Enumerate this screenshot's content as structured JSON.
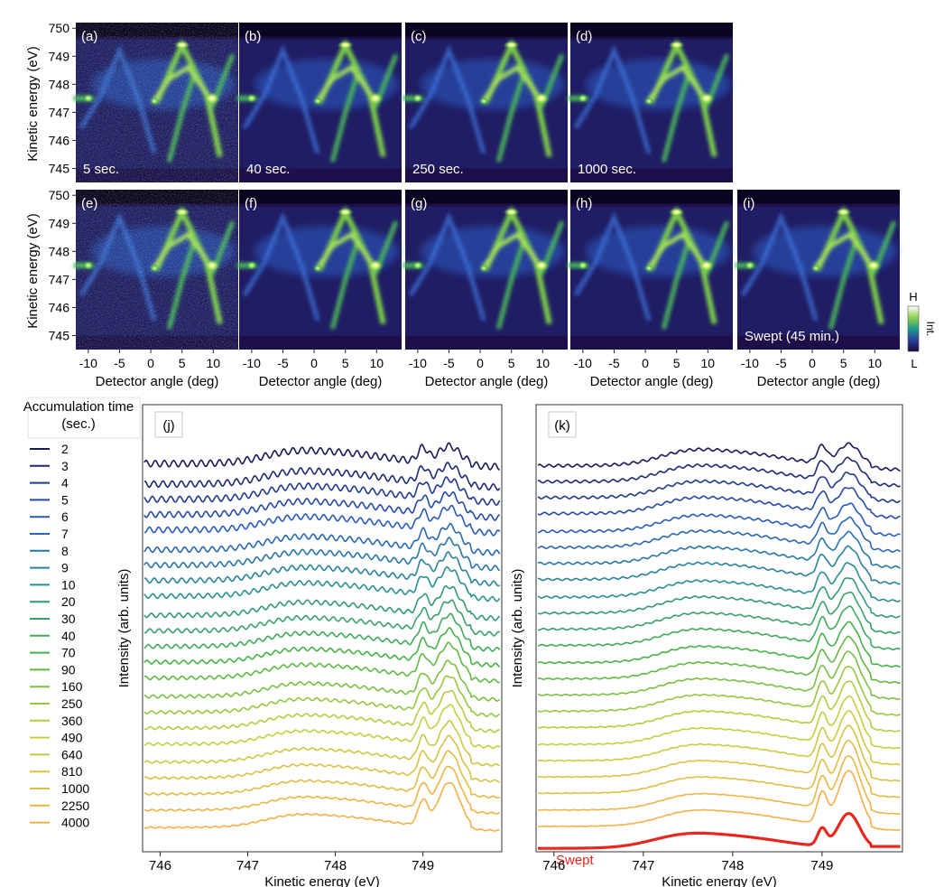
{
  "figure": {
    "maps_ylabel": "Kinetic energy (eV)",
    "maps_xlabel": "Detector angle (deg)",
    "colorbar": {
      "high": "H",
      "low": "L",
      "label": "Int."
    },
    "colors": {
      "dark": "#20205a",
      "mid": "#2aa36b",
      "light": "#f2b347",
      "swept": "#e8281e"
    }
  },
  "chart_data": [
    {
      "type": "heatmap",
      "panels": [
        {
          "label": "(a)",
          "caption": "5 sec."
        },
        {
          "label": "(b)",
          "caption": "40 sec."
        },
        {
          "label": "(c)",
          "caption": "250 sec."
        },
        {
          "label": "(d)",
          "caption": "1000 sec."
        },
        {
          "label": "(e)",
          "caption": ""
        },
        {
          "label": "(f)",
          "caption": ""
        },
        {
          "label": "(g)",
          "caption": ""
        },
        {
          "label": "(h)",
          "caption": ""
        },
        {
          "label": "(i)",
          "caption": "Swept (45 min.)"
        }
      ],
      "xlim": [
        -12,
        14
      ],
      "ylim": [
        744.5,
        750.2
      ],
      "xticks": [
        -10,
        -5,
        0,
        5,
        10
      ],
      "yticks": [
        745,
        746,
        747,
        748,
        749,
        750
      ],
      "xlabel": "Detector angle (deg)",
      "ylabel": "Kinetic energy (eV)"
    },
    {
      "type": "line",
      "panel": "(j)",
      "legend_title": "Accumulation time (sec.)",
      "series_names": [
        "2",
        "3",
        "4",
        "5",
        "6",
        "7",
        "8",
        "9",
        "10",
        "20",
        "30",
        "40",
        "70",
        "90",
        "160",
        "250",
        "360",
        "490",
        "640",
        "810",
        "1000",
        "2250",
        "4000"
      ],
      "xlim": [
        745.8,
        749.9
      ],
      "xticks": [
        746,
        747,
        748,
        749
      ],
      "xlabel": "Kinetic energy (eV)",
      "ylabel": "Intensity (arb. units)"
    },
    {
      "type": "line",
      "panel": "(k)",
      "extra_series": "Swept",
      "xlim": [
        745.8,
        749.9
      ],
      "xticks": [
        746,
        747,
        748,
        749
      ],
      "xlabel": "Kinetic energy (eV)",
      "ylabel": "Intensity (arb. units)"
    }
  ]
}
